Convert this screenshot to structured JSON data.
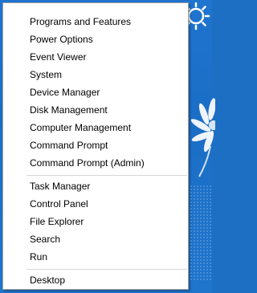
{
  "menu": {
    "items": [
      {
        "label": "Programs and Features"
      },
      {
        "label": "Power Options"
      },
      {
        "label": "Event Viewer"
      },
      {
        "label": "System"
      },
      {
        "label": "Device Manager"
      },
      {
        "label": "Disk Management"
      },
      {
        "label": "Computer Management"
      },
      {
        "label": "Command Prompt"
      },
      {
        "label": "Command Prompt (Admin)"
      },
      {
        "label": "Task Manager"
      },
      {
        "label": "Control Panel"
      },
      {
        "label": "File Explorer"
      },
      {
        "label": "Search"
      },
      {
        "label": "Run"
      },
      {
        "label": "Desktop"
      }
    ]
  },
  "colors": {
    "menu_background": "#ffffff",
    "menu_border": "#a0a0a0",
    "separator": "#d7d7d7",
    "wallpaper": "#1d6fc4"
  },
  "icons": [
    "sun-icon",
    "daisy-flower-icon"
  ]
}
